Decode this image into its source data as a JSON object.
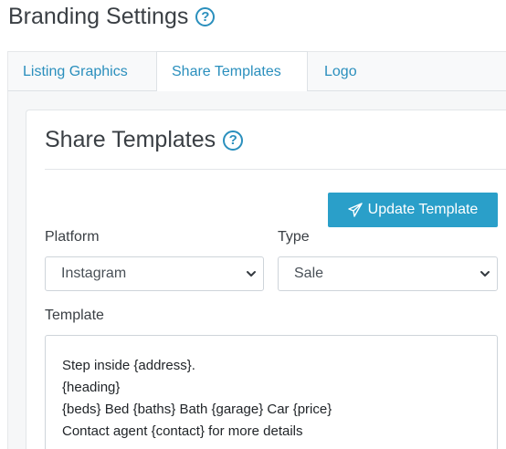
{
  "page": {
    "title": "Branding Settings",
    "help_icon": "question-circle-icon"
  },
  "tabs": [
    {
      "label": "Listing Graphics",
      "active": false
    },
    {
      "label": "Share Templates",
      "active": true
    },
    {
      "label": "Logo",
      "active": false
    }
  ],
  "card": {
    "title": "Share Templates",
    "help_icon": "question-circle-icon",
    "update_button": {
      "label": "Update Template",
      "icon": "paper-plane-icon"
    },
    "platform": {
      "label": "Platform",
      "value": "Instagram"
    },
    "type": {
      "label": "Type",
      "value": "Sale"
    },
    "template": {
      "label": "Template",
      "lines": [
        "Step inside {address}.",
        "{heading}",
        "{beds} Bed {baths} Bath {garage} Car {price}",
        "Contact agent {contact} for more details"
      ]
    }
  },
  "colors": {
    "accent": "#2a8fbd",
    "button": "#2a9fc9",
    "text": "#3a3f44"
  }
}
